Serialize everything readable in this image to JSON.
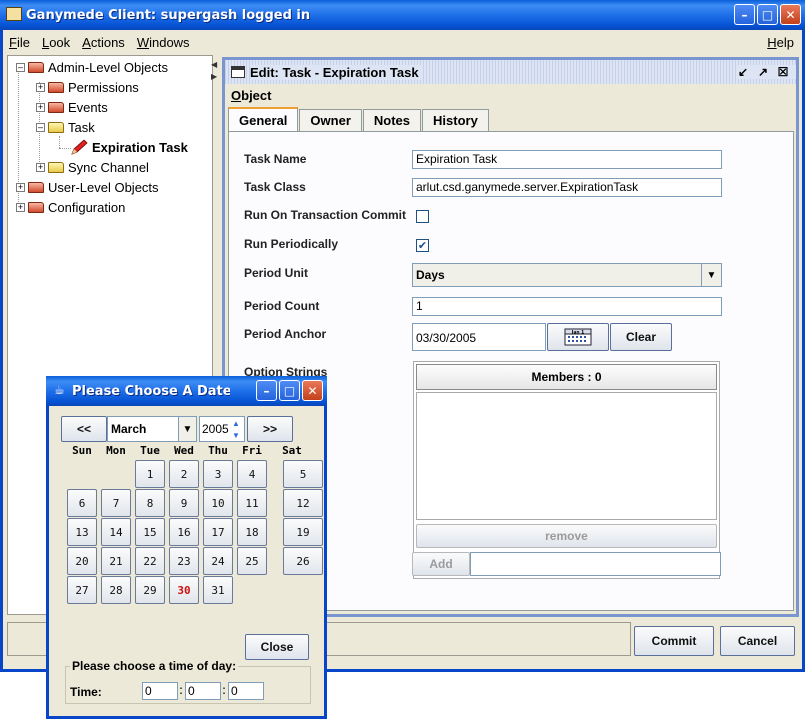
{
  "main_window": {
    "title": "Ganymede Client: supergash logged in",
    "menu": [
      "File",
      "Look",
      "Actions",
      "Windows"
    ],
    "help": "Help"
  },
  "tree": {
    "admin": "Admin-Level Objects",
    "permissions": "Permissions",
    "events": "Events",
    "task": "Task",
    "expiration_task": "Expiration Task",
    "sync_channel": "Sync Channel",
    "user_level": "User-Level Objects",
    "configuration": "Configuration"
  },
  "edit_frame": {
    "title": "Edit: Task - Expiration Task",
    "menu": "Object",
    "tabs": [
      "General",
      "Owner",
      "Notes",
      "History"
    ],
    "fields": {
      "task_name_label": "Task Name",
      "task_name_value": "Expiration Task",
      "task_class_label": "Task Class",
      "task_class_value": "arlut.csd.ganymede.server.ExpirationTask",
      "run_on_commit_label": "Run On Transaction Commit",
      "run_on_commit_checked": false,
      "run_periodically_label": "Run Periodically",
      "run_periodically_checked": true,
      "check_mark": "✔",
      "period_unit_label": "Period Unit",
      "period_unit_value": "Days",
      "period_count_label": "Period Count",
      "period_count_value": "1",
      "period_anchor_label": "Period Anchor",
      "period_anchor_value": "03/30/2005",
      "calendar_icon_text": "Jan 1",
      "clear_label": "Clear",
      "option_strings_label": "Option Strings",
      "members_header": "Members : 0",
      "remove_label": "remove",
      "add_label": "Add"
    },
    "commit_label": "Commit",
    "cancel_label": "Cancel"
  },
  "date_dialog": {
    "title": "Please Choose A Date And ...",
    "prev": "<<",
    "next": ">>",
    "month": "March",
    "year": "2005",
    "weekdays": [
      "Sun",
      "Mon",
      "Tue",
      "Wed",
      "Thu",
      "Fri",
      "Sat"
    ],
    "days": [
      "1",
      "2",
      "3",
      "4",
      "5",
      "6",
      "7",
      "8",
      "9",
      "10",
      "11",
      "12",
      "13",
      "14",
      "15",
      "16",
      "17",
      "18",
      "19",
      "20",
      "21",
      "22",
      "23",
      "24",
      "25",
      "26",
      "27",
      "28",
      "29",
      "30",
      "31"
    ],
    "selected_day": "30",
    "close_label": "Close",
    "time_legend": "Please choose a time of day:",
    "time_label": "Time:",
    "hour": "0",
    "minute": "0",
    "second": "0",
    "separator": ":"
  },
  "colors": {
    "title_bar": "#0a5fd8",
    "selected_day": "#d01010",
    "tab_highlight": "#f0a030"
  }
}
